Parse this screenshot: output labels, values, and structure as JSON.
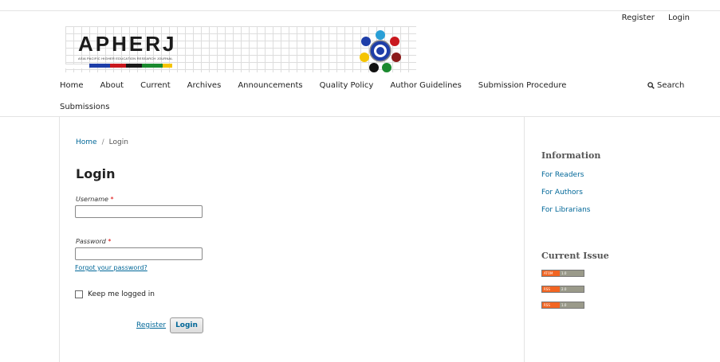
{
  "user_nav": {
    "register": "Register",
    "login": "Login"
  },
  "logo": {
    "title": "APHERJ",
    "subtitle": "ASIA PACIFIC HIGHER EDUCATION RESEARCH JOURNAL"
  },
  "main_nav": {
    "items": [
      "Home",
      "About",
      "Current",
      "Archives",
      "Announcements",
      "Quality Policy",
      "Author Guidelines",
      "Submission Procedure",
      "Submissions"
    ],
    "search": "Search"
  },
  "breadcrumb": {
    "home": "Home",
    "separator": "/",
    "current": "Login"
  },
  "form": {
    "title": "Login",
    "username_label": "Username",
    "password_label": "Password",
    "required_mark": "*",
    "forgot": "Forgot your password?",
    "keep_logged_in": "Keep me logged in",
    "register": "Register",
    "login": "Login"
  },
  "sidebar": {
    "info_heading": "Information",
    "links": [
      "For Readers",
      "For Authors",
      "For Librarians"
    ],
    "current_issue_heading": "Current Issue",
    "feeds": [
      {
        "left": "ATOM",
        "right": "1.0"
      },
      {
        "left": "RSS",
        "right": "2.0"
      },
      {
        "left": "RSS",
        "right": "1.0"
      }
    ]
  },
  "colors": {
    "link": "#006798",
    "feed_orange": "#f26522",
    "feed_gray": "#9a9a8a",
    "required": "#dd0000"
  }
}
